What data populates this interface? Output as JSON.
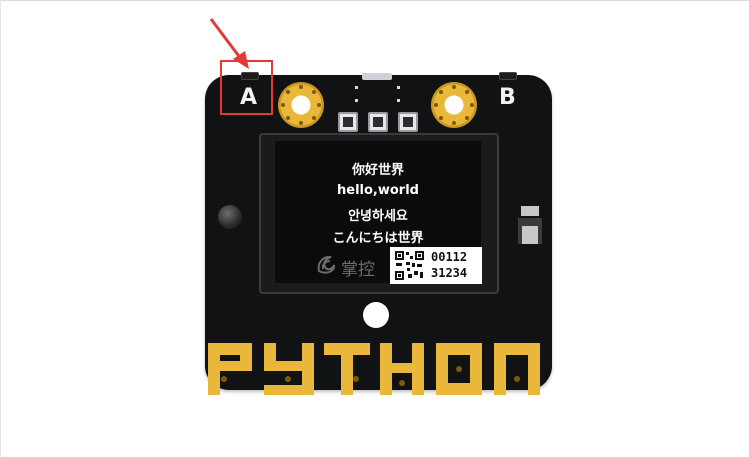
{
  "board": {
    "button_a_label": "A",
    "button_b_label": "B",
    "screen_lines": [
      "你好世界",
      "hello,world",
      "안녕하세요",
      "こんにちは世界"
    ],
    "logo_text": "掌控",
    "qr_numbers": [
      "00112",
      "31234"
    ],
    "brand_text": "PYTHON"
  },
  "colors": {
    "board": "#111213",
    "gold": "#e9b83a",
    "callout": "#e53935"
  },
  "icons": {
    "arrow": "red-arrow-icon",
    "logo": "swirl-logo-icon",
    "qr": "qr-code-icon"
  }
}
